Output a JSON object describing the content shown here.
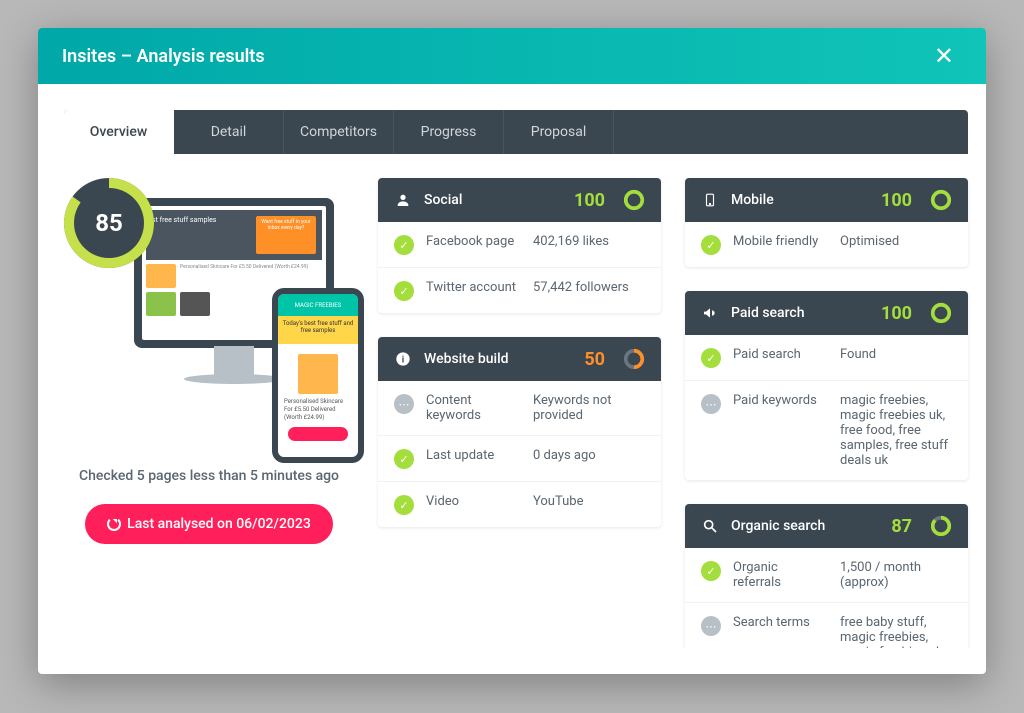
{
  "modal_title": "Insites – Analysis results",
  "tabs": [
    "Overview",
    "Detail",
    "Competitors",
    "Progress",
    "Proposal"
  ],
  "score": "85",
  "status_text": "Checked 5 pages less than 5 minutes ago",
  "analyse_button": "Last analysed on 06/02/2023",
  "cards": {
    "social": {
      "title": "Social",
      "score": "100",
      "rows": [
        {
          "status": "ok",
          "label": "Facebook page",
          "value": "402,169 likes"
        },
        {
          "status": "ok",
          "label": "Twitter account",
          "value": "57,442 followers"
        }
      ]
    },
    "website": {
      "title": "Website build",
      "score": "50",
      "rows": [
        {
          "status": "info",
          "label": "Content keywords",
          "value": "Keywords not provided"
        },
        {
          "status": "ok",
          "label": "Last update",
          "value": "0 days ago"
        },
        {
          "status": "ok",
          "label": "Video",
          "value": "YouTube"
        }
      ]
    },
    "mobile": {
      "title": "Mobile",
      "score": "100",
      "rows": [
        {
          "status": "ok",
          "label": "Mobile friendly",
          "value": "Optimised"
        }
      ]
    },
    "paid": {
      "title": "Paid search",
      "score": "100",
      "rows": [
        {
          "status": "ok",
          "label": "Paid search",
          "value": "Found"
        },
        {
          "status": "info",
          "label": "Paid keywords",
          "value": "magic freebies, magic freebies uk, free food, free samples, free stuff deals uk"
        }
      ]
    },
    "organic": {
      "title": "Organic search",
      "score": "87",
      "rows": [
        {
          "status": "ok",
          "label": "Organic referrals",
          "value": "1,500 / month (approx)"
        },
        {
          "status": "info",
          "label": "Search terms",
          "value": "free baby stuff, magic freebies, magic freebies uk, freebies co, free sex"
        }
      ]
    }
  },
  "mock": {
    "hero": "st free stuff\nsamples",
    "cta": "Want free stuff in your inbox every day?",
    "phone_brand": "MAGIC FREEBIES",
    "phone_banner": "Today's best free stuff and free samples",
    "phone_prod": "Personalised Skincare For £5.50 Delivered (Worth £24.99)"
  }
}
